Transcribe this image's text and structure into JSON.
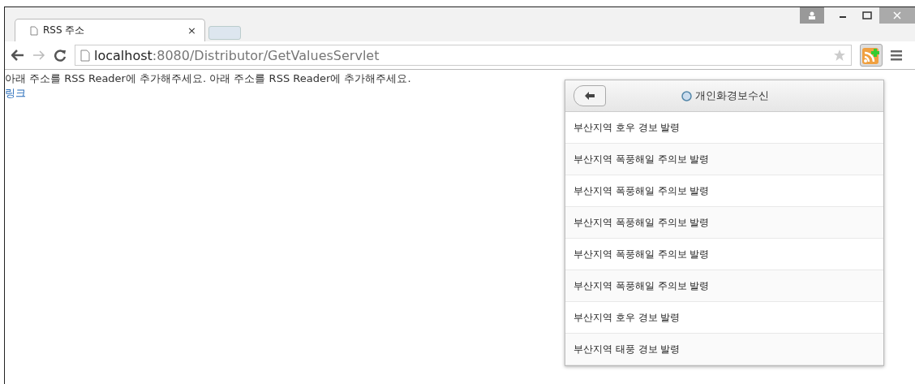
{
  "tabs": [
    {
      "label": "RSS 주소",
      "close": "×",
      "selected": true
    }
  ],
  "address": {
    "host": "localhost",
    "rest": ":8080/Distributor/GetValuesServlet"
  },
  "page": {
    "text": "아래 주소를 RSS Reader에 추가해주세요. 아래 주소를 RSS Reader에 추가해주세요.",
    "link": "링크"
  },
  "popup": {
    "title": "개인화경보수신",
    "items": [
      {
        "label": "부산지역 호우 경보 발령"
      },
      {
        "label": "부산지역 폭풍해일 주의보 발령"
      },
      {
        "label": "부산지역 폭풍해일 주의보 발령"
      },
      {
        "label": "부산지역 폭풍해일 주의보 발령"
      },
      {
        "label": "부산지역 폭풍해일 주의보 발령"
      },
      {
        "label": "부산지역 폭풍해일 주의보 발령"
      },
      {
        "label": "부산지역 호우 경보 발령"
      },
      {
        "label": "부산지역 태풍 경보 발령"
      }
    ]
  }
}
